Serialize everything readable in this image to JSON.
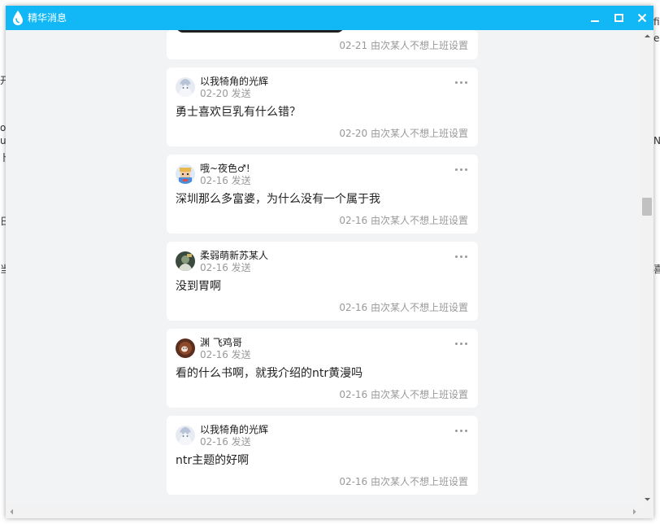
{
  "window": {
    "title": "精华消息",
    "accent_color": "#12b7f5",
    "logo_icon": "qq-drop-logo-icon",
    "controls": [
      "minimize",
      "maximize",
      "close"
    ]
  },
  "top_card": {
    "footer": "02-21 由次某人不想上班设置"
  },
  "messages": [
    {
      "author": "以我犄角的光辉",
      "date": "02-20 发送",
      "text": "勇士喜欢巨乳有什么错？",
      "footer": "02-20 由次某人不想上班设置",
      "avatar": "anime-girl-avatar"
    },
    {
      "author": "哦~夜色♂!",
      "date": "02-16 发送",
      "text": "深圳那么多富婆，为什么没有一个属于我",
      "footer": "02-16 由次某人不想上班设置",
      "avatar": "pixel-character-avatar"
    },
    {
      "author": "柔弱萌新苏某人",
      "date": "02-16 发送",
      "text": "没到胃啊",
      "footer": "02-16 由次某人不想上班设置",
      "avatar": "dark-photo-avatar"
    },
    {
      "author": "渊 飞鸡哥",
      "date": "02-16 发送",
      "text": "看的什么书啊，就我介绍的ntr黄漫吗",
      "footer": "02-16 由次某人不想上班设置",
      "avatar": "brown-photo-avatar"
    },
    {
      "author": "以我犄角的光辉",
      "date": "02-16 发送",
      "text": "ntr主题的好啊",
      "footer": "02-16 由次某人不想上班设置",
      "avatar": "anime-girl-avatar"
    }
  ],
  "background_fragments": [
    "开",
    "or",
    "ul",
    "卜",
    "日",
    "当",
    "fi",
    "el",
    "N",
    "喜"
  ]
}
